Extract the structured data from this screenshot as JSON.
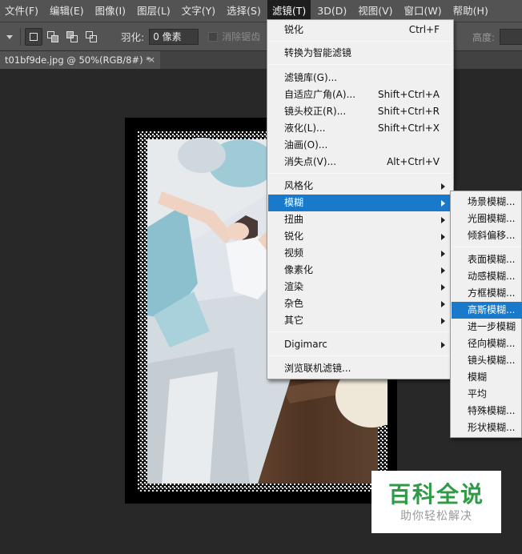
{
  "menubar": {
    "items": [
      {
        "label": "文件(F)"
      },
      {
        "label": "编辑(E)"
      },
      {
        "label": "图像(I)"
      },
      {
        "label": "图层(L)"
      },
      {
        "label": "文字(Y)"
      },
      {
        "label": "选择(S)"
      },
      {
        "label": "滤镜(T)"
      },
      {
        "label": "3D(D)"
      },
      {
        "label": "视图(V)"
      },
      {
        "label": "窗口(W)"
      },
      {
        "label": "帮助(H)"
      }
    ]
  },
  "options": {
    "feather_label": "羽化:",
    "feather_value": "0 像素",
    "antialias_label": "消除锯齿",
    "height_label": "高度:"
  },
  "document": {
    "tab_title": "t01bf9de.jpg @ 50%(RGB/8#) *",
    "close_glyph": "×"
  },
  "filter_menu": {
    "items": [
      {
        "label": "锐化",
        "shortcut": "Ctrl+F"
      },
      {
        "label": "转换为智能滤镜",
        "shortcut": ""
      },
      {
        "label": "滤镜库(G)...",
        "shortcut": ""
      },
      {
        "label": "自适应广角(A)...",
        "shortcut": "Shift+Ctrl+A"
      },
      {
        "label": "镜头校正(R)...",
        "shortcut": "Shift+Ctrl+R"
      },
      {
        "label": "液化(L)...",
        "shortcut": "Shift+Ctrl+X"
      },
      {
        "label": "油画(O)...",
        "shortcut": ""
      },
      {
        "label": "消失点(V)...",
        "shortcut": "Alt+Ctrl+V"
      },
      {
        "label": "风格化"
      },
      {
        "label": "模糊"
      },
      {
        "label": "扭曲"
      },
      {
        "label": "锐化"
      },
      {
        "label": "视频"
      },
      {
        "label": "像素化"
      },
      {
        "label": "渲染"
      },
      {
        "label": "杂色"
      },
      {
        "label": "其它"
      },
      {
        "label": "Digimarc"
      },
      {
        "label": "浏览联机滤镜..."
      }
    ]
  },
  "blur_submenu": {
    "items": [
      {
        "label": "场景模糊..."
      },
      {
        "label": "光圈模糊..."
      },
      {
        "label": "倾斜偏移..."
      },
      {
        "label": "表面模糊..."
      },
      {
        "label": "动感模糊..."
      },
      {
        "label": "方框模糊..."
      },
      {
        "label": "高斯模糊..."
      },
      {
        "label": "进一步模糊"
      },
      {
        "label": "径向模糊..."
      },
      {
        "label": "镜头模糊..."
      },
      {
        "label": "模糊"
      },
      {
        "label": "平均"
      },
      {
        "label": "特殊模糊..."
      },
      {
        "label": "形状模糊..."
      }
    ]
  },
  "watermark": {
    "title": "百科全说",
    "subtitle": "助你轻松解决"
  }
}
